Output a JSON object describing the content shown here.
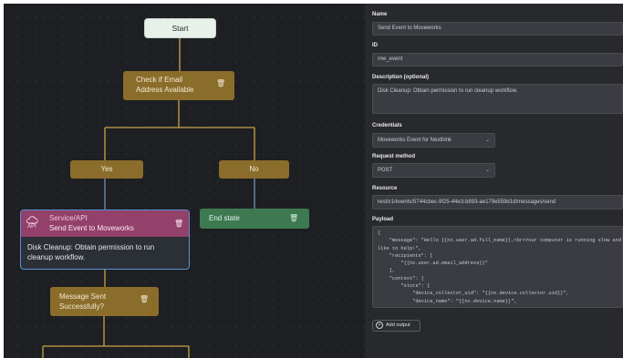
{
  "flow": {
    "start_label": "Start",
    "check_label": [
      "Check if Email",
      "Address Available"
    ],
    "yes_label": "Yes",
    "no_label": "No",
    "end_label": "End state",
    "api_type": "Service/API",
    "api_icon_text": "API",
    "api_name": "Send Event to Moveworks",
    "api_body": [
      "Disk Cleanup: Obtain permission to run",
      "cleanup workflow."
    ],
    "msg_label": [
      "Message Sent",
      "Successfully?"
    ],
    "trash_icon": "🗑"
  },
  "panel": {
    "name_label": "Name",
    "name_value": "Send Event to Moveworks",
    "id_label": "ID",
    "id_value": "mw_event",
    "desc_label": "Description (optional)",
    "desc_value": "Disk Cleanup:  Obtain permission to run cleanup workflow.",
    "cred_label": "Credentials",
    "cred_value": "Moveworks Event for Nexthink",
    "method_label": "Request method",
    "method_value": "POST",
    "resource_label": "Resource",
    "resource_value": "rest/v1/events/5744cbec-9f25-44e3-b893-ae179e559d1d/messages/send",
    "payload_label": "Payload",
    "payload_lines": [
      "{",
      "    \"message\": \"Hello {{nx.user.ad.full_name}},<br>Your computer is running slow and we'd",
      "like to help!\",",
      "    \"recipients\": [",
      "        \"{{nx.user.ad.email_address}}\"",
      "    ],",
      "    \"context\": {",
      "        \"slots\": {",
      "            \"device_collector_uid\": \"{{nx.device.collector.uid}}\",",
      "            \"device_name\": \"{{nx.device.name}}\","
    ],
    "add_output_label": "Add output"
  }
}
